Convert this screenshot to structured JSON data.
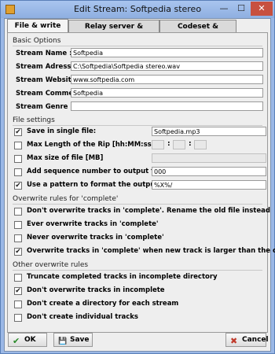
{
  "window": {
    "title": "Edit Stream:  Softpedia stereo",
    "buttons": {
      "minimize": "—",
      "maximize": "☐",
      "close": "✕"
    }
  },
  "tabs": [
    {
      "label": "File & write rules",
      "active": true
    },
    {
      "label": "Relay server & connections",
      "active": false
    },
    {
      "label": "Codeset & Splitpoints",
      "active": false
    }
  ],
  "basic_options": {
    "title": "Basic Options",
    "stream_name": {
      "label": "Stream Name :",
      "value": "Softpedia"
    },
    "stream_address": {
      "label": "Stream Adress :",
      "value": "C:\\Softpedia\\Softpedia stereo.wav"
    },
    "stream_website": {
      "label": "Stream Website :",
      "value": "www.softpedia.com"
    },
    "stream_comment": {
      "label": "Stream Comment :",
      "value": "Softpedia"
    },
    "stream_genre": {
      "label": "Stream Genre :",
      "value": ""
    }
  },
  "file_settings": {
    "title": "File settings",
    "save_single": {
      "label": "Save in single file:",
      "checked": true,
      "value": "Softpedia.mp3"
    },
    "max_length": {
      "label": "Max Length of the Rip [hh:MM:ss]",
      "checked": false,
      "sep": ":"
    },
    "max_size": {
      "label": "Max size of file [MB]",
      "checked": false
    },
    "add_seq": {
      "label": "Add sequence number to output filenames",
      "checked": false,
      "value": "000"
    },
    "use_pattern": {
      "label": "Use a pattern to format the output file names",
      "checked": true,
      "value": "%X%/"
    }
  },
  "overwrite_complete": {
    "title": "Overwrite rules for 'complete'",
    "items": [
      {
        "label": "Don't overwrite tracks in 'complete'. Rename the old file instead",
        "checked": false
      },
      {
        "label": "Ever overwrite tracks in 'complete'",
        "checked": false
      },
      {
        "label": "Never overwrite tracks in 'complete'",
        "checked": false
      },
      {
        "label": "Overwrite tracks in 'complete' when new track is larger than the old",
        "checked": true
      }
    ]
  },
  "other_overwrite": {
    "title": "Other overwrite rules",
    "items": [
      {
        "label": "Truncate completed tracks in incomplete directory",
        "checked": false
      },
      {
        "label": "Don't overwrite tracks in incomplete",
        "checked": true
      },
      {
        "label": "Don't create a directory for each stream",
        "checked": false
      },
      {
        "label": "Don't create individual tracks",
        "checked": false
      }
    ]
  },
  "footer": {
    "ok": "OK",
    "save": "Save",
    "cancel": "Cancel"
  },
  "icons": {
    "check": "✔",
    "ok_icon": "✔",
    "save_icon": "💾",
    "cancel_icon": "✖"
  }
}
